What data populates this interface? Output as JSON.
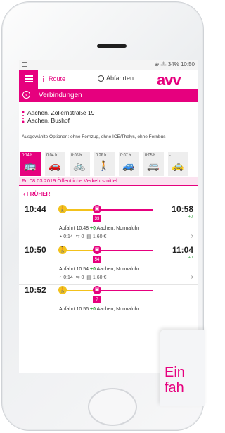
{
  "status_bar": {
    "right_text": "34% 10:50"
  },
  "header": {
    "route_tab": "Route",
    "departures_tab": "Abfahrten",
    "logo": "avv"
  },
  "titlebar": {
    "title": "Verbindungen"
  },
  "route": {
    "from": "Aachen, Zollernstraße 19",
    "to": "Aachen, Bushof"
  },
  "options_text": "Ausgewählte Optionen: ohne Fernzug, ohne ICE/Thalys, ohne Fernbus",
  "modes": [
    {
      "time": "0:14 h",
      "icon": "bus-icon"
    },
    {
      "time": "0:04 h",
      "icon": "car-icon"
    },
    {
      "time": "0:06 h",
      "icon": "bicycle-icon"
    },
    {
      "time": "0:26 h",
      "icon": "walk-icon"
    },
    {
      "time": "0:07 h",
      "icon": "park-ride-icon"
    },
    {
      "time": "0:05 h",
      "icon": "bike-ride-icon"
    },
    {
      "time": "-",
      "icon": "taxi-icon"
    }
  ],
  "date_line": "Fr. 08.03.2019 Öffentliche Verkehrsmittel",
  "earlier_label": "FRÜHER",
  "connections": [
    {
      "dep": "10:44",
      "arr": "10:58",
      "arr_delay": "+0",
      "line": "33",
      "detail_pre": "Abfahrt 10:48 ",
      "detail_delay": "+0",
      "detail_post": " Aachen, Normaluhr",
      "duration": "0:14",
      "changes": "0",
      "price": "1,60 €"
    },
    {
      "dep": "10:50",
      "arr": "11:04",
      "arr_delay": "+0",
      "line": "54",
      "detail_pre": "Abfahrt 10:54 ",
      "detail_delay": "+0",
      "detail_post": " Aachen, Normaluhr",
      "duration": "0:14",
      "changes": "0",
      "price": "1,60 €"
    },
    {
      "dep": "10:52",
      "line": "7",
      "detail_pre": "Abfahrt 10:56 ",
      "detail_delay": "+0",
      "detail_post": " Aachen, Normaluhr"
    }
  ],
  "overlay": {
    "line1": "Ein",
    "line2": "fah"
  },
  "colors": {
    "brand": "#e6007e",
    "walk": "#f3c21b",
    "ontime": "#2e9d3a"
  }
}
